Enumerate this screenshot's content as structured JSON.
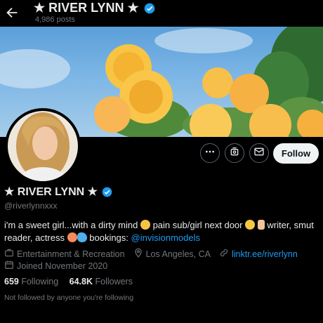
{
  "header": {
    "title": "★ RIVER LYNN ★",
    "posts": "4,986 posts"
  },
  "profile": {
    "name": "★ RIVER LYNN ★",
    "handle": "@riverlynnxxx",
    "follow_label": "Follow",
    "bio": {
      "part1": "i'm a sweet girl...with a dirty mind",
      "part2": "pain sub/girl next door",
      "part3": "writer, smut reader, actress",
      "part4": "bookings:",
      "mention": "@invisionmodels"
    },
    "category": "Entertainment & Recreation",
    "location": "Los Angeles, CA",
    "website": "linktr.ee/riverlynn",
    "joined": "Joined November 2020",
    "following_count": "659",
    "following_label": "Following",
    "followers_count": "64.8K",
    "followers_label": "Followers",
    "not_followed": "Not followed by anyone you're following"
  },
  "colors": {
    "accent": "#1d9bf0",
    "verified": "#1d9bf0",
    "muted": "#71767b"
  },
  "icons": [
    "back-arrow-icon",
    "verified-icon",
    "more-icon",
    "subscribe-icon",
    "message-icon",
    "briefcase-icon",
    "location-icon",
    "link-icon",
    "calendar-icon"
  ]
}
